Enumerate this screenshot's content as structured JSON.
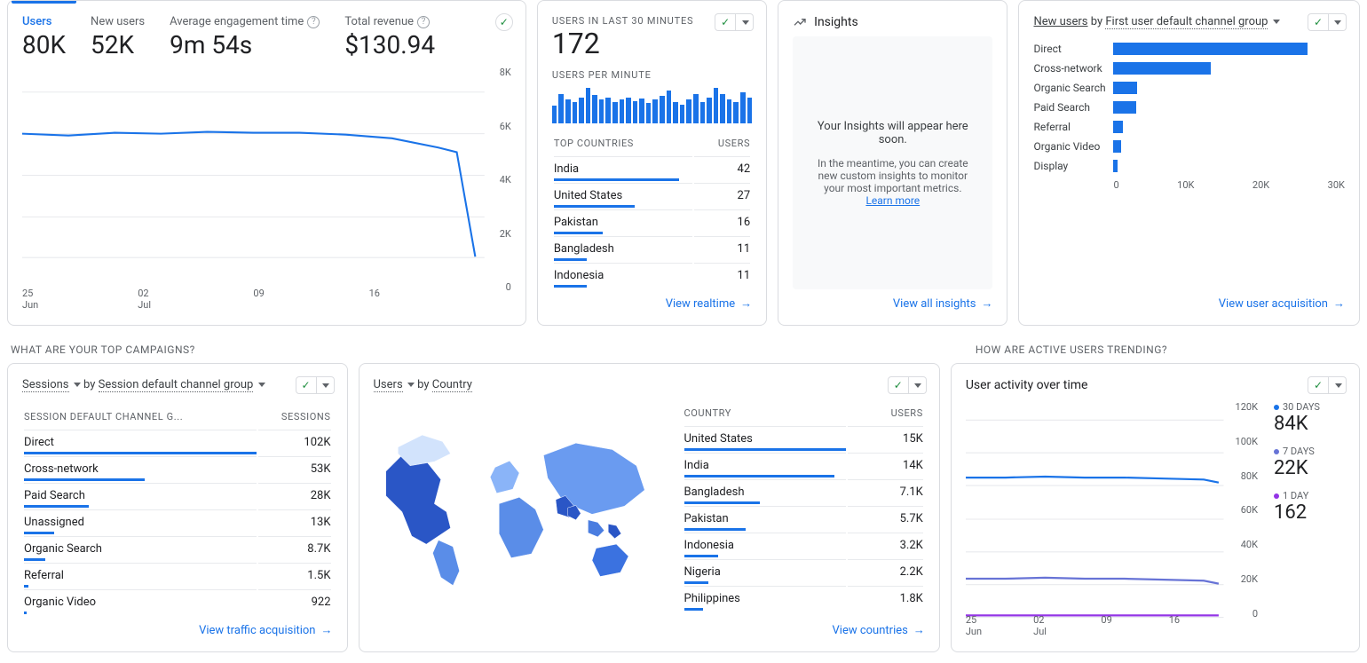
{
  "overview": {
    "metrics": [
      {
        "label": "Users",
        "value": "80K",
        "active": true
      },
      {
        "label": "New users",
        "value": "52K"
      },
      {
        "label": "Average engagement time",
        "value": "9m 54s",
        "help": true
      },
      {
        "label": "Total revenue",
        "value": "$130.94",
        "help": true
      }
    ],
    "chart": {
      "yticks": [
        "8K",
        "6K",
        "4K",
        "2K",
        "0"
      ],
      "xticks": [
        "25\nJun",
        "02\nJul",
        "09",
        "16"
      ]
    }
  },
  "realtime": {
    "title": "USERS IN LAST 30 MINUTES",
    "value": "172",
    "spark_title": "USERS PER MINUTE",
    "spark": [
      15,
      25,
      20,
      18,
      22,
      30,
      24,
      20,
      22,
      18,
      20,
      22,
      19,
      21,
      17,
      20,
      23,
      28,
      18,
      16,
      20,
      25,
      18,
      22,
      30,
      25,
      20,
      18,
      26,
      22
    ],
    "table_headers": [
      "TOP COUNTRIES",
      "USERS"
    ],
    "rows": [
      {
        "country": "India",
        "users": "42",
        "bar": 90
      },
      {
        "country": "United States",
        "users": "27",
        "bar": 58
      },
      {
        "country": "Pakistan",
        "users": "16",
        "bar": 35
      },
      {
        "country": "Bangladesh",
        "users": "11",
        "bar": 24
      },
      {
        "country": "Indonesia",
        "users": "11",
        "bar": 24
      }
    ],
    "link": "View realtime"
  },
  "insights": {
    "title": "Insights",
    "msg": "Your Insights will appear here soon.",
    "sub1": "In the meantime, you can create new custom insights to monitor your most important metrics.",
    "learn": "Learn more",
    "link": "View all insights"
  },
  "newusers": {
    "sel1": "New users",
    "mid": "by",
    "sel2": "First user default channel group",
    "rows": [
      {
        "label": "Direct",
        "v": 26000
      },
      {
        "label": "Cross-network",
        "v": 13000
      },
      {
        "label": "Organic Search",
        "v": 3200
      },
      {
        "label": "Paid Search",
        "v": 3000
      },
      {
        "label": "Referral",
        "v": 1200
      },
      {
        "label": "Organic Video",
        "v": 1000
      },
      {
        "label": "Display",
        "v": 500
      }
    ],
    "max": 30000,
    "axis": [
      "0",
      "10K",
      "20K",
      "30K"
    ],
    "link": "View user acquisition"
  },
  "section_campaigns": "WHAT ARE YOUR TOP CAMPAIGNS?",
  "section_trending": "HOW ARE ACTIVE USERS TRENDING?",
  "sessions": {
    "sel1": "Sessions",
    "mid": "by",
    "sel2": "Session default channel group",
    "headers": [
      "SESSION DEFAULT CHANNEL G...",
      "SESSIONS"
    ],
    "rows": [
      {
        "label": "Direct",
        "v": "102K",
        "bar": 100
      },
      {
        "label": "Cross-network",
        "v": "53K",
        "bar": 52
      },
      {
        "label": "Paid Search",
        "v": "28K",
        "bar": 28
      },
      {
        "label": "Unassigned",
        "v": "13K",
        "bar": 13
      },
      {
        "label": "Organic Search",
        "v": "8.7K",
        "bar": 9
      },
      {
        "label": "Referral",
        "v": "1.5K",
        "bar": 2
      },
      {
        "label": "Organic Video",
        "v": "922",
        "bar": 1
      }
    ],
    "link": "View traffic acquisition"
  },
  "usersByCountry": {
    "sel1": "Users",
    "mid": "by",
    "sel2": "Country",
    "headers": [
      "COUNTRY",
      "USERS"
    ],
    "rows": [
      {
        "label": "United States",
        "v": "15K",
        "bar": 100
      },
      {
        "label": "India",
        "v": "14K",
        "bar": 93
      },
      {
        "label": "Bangladesh",
        "v": "7.1K",
        "bar": 47
      },
      {
        "label": "Pakistan",
        "v": "5.7K",
        "bar": 38
      },
      {
        "label": "Indonesia",
        "v": "3.2K",
        "bar": 21
      },
      {
        "label": "Nigeria",
        "v": "2.2K",
        "bar": 15
      },
      {
        "label": "Philippines",
        "v": "1.8K",
        "bar": 12
      }
    ],
    "link": "View countries"
  },
  "activity": {
    "title": "User activity over time",
    "yticks": [
      "120K",
      "100K",
      "80K",
      "60K",
      "40K",
      "20K",
      "0"
    ],
    "xticks": [
      "25\nJun",
      "02\nJul",
      "09",
      "16"
    ],
    "legend": [
      {
        "label": "30 DAYS",
        "value": "84K",
        "color": "#1a73e8"
      },
      {
        "label": "7 DAYS",
        "value": "22K",
        "color": "#6773d6"
      },
      {
        "label": "1 DAY",
        "value": "162",
        "color": "#9334e6"
      }
    ]
  },
  "chart_data": [
    {
      "type": "line",
      "title": "Users (overview timeseries)",
      "x": [
        "25 Jun",
        "02 Jul",
        "09",
        "16"
      ],
      "y_approx_start": 6000,
      "y_approx_end": 0,
      "note": "line ~6K steady then drops to ~0 on last day",
      "ylim": [
        0,
        8000
      ]
    },
    {
      "type": "bar",
      "title": "Users per minute",
      "x_count": 30,
      "values": [
        15,
        25,
        20,
        18,
        22,
        30,
        24,
        20,
        22,
        18,
        20,
        22,
        19,
        21,
        17,
        20,
        23,
        28,
        18,
        16,
        20,
        25,
        18,
        22,
        30,
        25,
        20,
        18,
        26,
        22
      ]
    },
    {
      "type": "bar",
      "orientation": "horizontal",
      "title": "New users by First user default channel group",
      "categories": [
        "Direct",
        "Cross-network",
        "Organic Search",
        "Paid Search",
        "Referral",
        "Organic Video",
        "Display"
      ],
      "values": [
        26000,
        13000,
        3200,
        3000,
        1200,
        1000,
        500
      ],
      "xlim": [
        0,
        30000
      ]
    },
    {
      "type": "bar",
      "orientation": "horizontal",
      "title": "Sessions by Session default channel group",
      "categories": [
        "Direct",
        "Cross-network",
        "Paid Search",
        "Unassigned",
        "Organic Search",
        "Referral",
        "Organic Video"
      ],
      "values": [
        102000,
        53000,
        28000,
        13000,
        8700,
        1500,
        922
      ]
    },
    {
      "type": "bar",
      "orientation": "horizontal",
      "title": "Users by Country",
      "categories": [
        "United States",
        "India",
        "Bangladesh",
        "Pakistan",
        "Indonesia",
        "Nigeria",
        "Philippines"
      ],
      "values": [
        15000,
        14000,
        7100,
        5700,
        3200,
        2200,
        1800
      ]
    },
    {
      "type": "line",
      "title": "User activity over time",
      "series": [
        {
          "name": "30 DAYS",
          "approx": 84000
        },
        {
          "name": "7 DAYS",
          "approx": 22000
        },
        {
          "name": "1 DAY",
          "approx": 162
        }
      ],
      "ylim": [
        0,
        120000
      ],
      "x": [
        "25 Jun",
        "02 Jul",
        "09",
        "16"
      ]
    }
  ]
}
